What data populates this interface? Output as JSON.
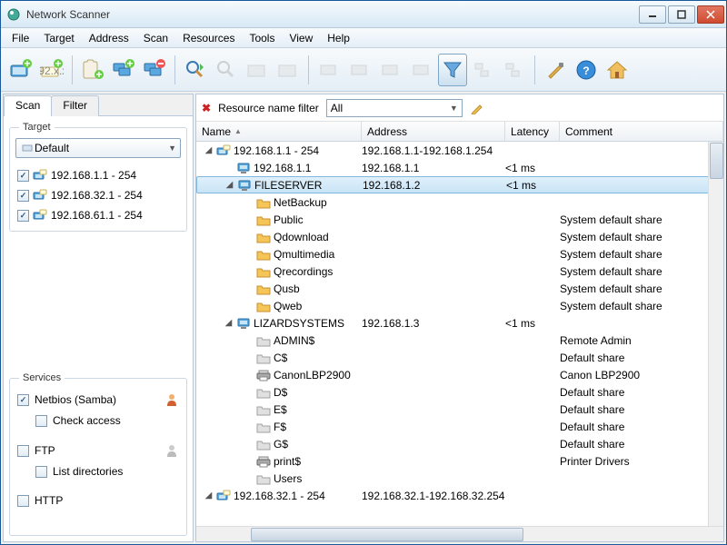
{
  "title": "Network Scanner",
  "menu": [
    "File",
    "Target",
    "Address",
    "Scan",
    "Resources",
    "Tools",
    "View",
    "Help"
  ],
  "left": {
    "tabs": [
      "Scan",
      "Filter"
    ],
    "target_legend": "Target",
    "target_combo": "Default",
    "targets": [
      {
        "checked": true,
        "label": "192.168.1.1 - 254"
      },
      {
        "checked": true,
        "label": "192.168.32.1 - 254"
      },
      {
        "checked": true,
        "label": "192.168.61.1 - 254"
      }
    ],
    "services_legend": "Services",
    "services": [
      {
        "checked": true,
        "label": "Netbios (Samba)",
        "icon": "person"
      },
      {
        "checked": false,
        "label": "Check access",
        "sub": true
      },
      {
        "checked": false,
        "label": "FTP",
        "icon": "person-grey",
        "gap": true
      },
      {
        "checked": false,
        "label": "List directories",
        "sub": true
      },
      {
        "checked": false,
        "label": "HTTP",
        "gap": true
      }
    ]
  },
  "filter": {
    "label": "Resource name filter",
    "value": "All"
  },
  "columns": {
    "name": "Name",
    "addr": "Address",
    "lat": "Latency",
    "com": "Comment"
  },
  "rows": [
    {
      "level": 1,
      "exp": "▼",
      "icon": "range",
      "name": "192.168.1.1 - 254",
      "addr": "192.168.1.1-192.168.1.254"
    },
    {
      "level": 2,
      "icon": "host",
      "name": "192.168.1.1",
      "addr": "192.168.1.1",
      "lat": "<1 ms"
    },
    {
      "level": 2,
      "exp": "▼",
      "icon": "host",
      "name": "FILESERVER",
      "addr": "192.168.1.2",
      "lat": "<1 ms",
      "selected": true
    },
    {
      "level": 3,
      "icon": "folder",
      "name": "NetBackup"
    },
    {
      "level": 3,
      "icon": "folder",
      "name": "Public",
      "com": "System default share"
    },
    {
      "level": 3,
      "icon": "folder",
      "name": "Qdownload",
      "com": "System default share"
    },
    {
      "level": 3,
      "icon": "folder",
      "name": "Qmultimedia",
      "com": "System default share"
    },
    {
      "level": 3,
      "icon": "folder",
      "name": "Qrecordings",
      "com": "System default share"
    },
    {
      "level": 3,
      "icon": "folder",
      "name": "Qusb",
      "com": "System default share"
    },
    {
      "level": 3,
      "icon": "folder",
      "name": "Qweb",
      "com": "System default share"
    },
    {
      "level": 2,
      "exp": "▼",
      "icon": "host",
      "name": "LIZARDSYSTEMS",
      "addr": "192.168.1.3",
      "lat": "<1 ms"
    },
    {
      "level": 3,
      "icon": "folder-g",
      "name": "ADMIN$",
      "com": "Remote Admin"
    },
    {
      "level": 3,
      "icon": "folder-g",
      "name": "C$",
      "com": "Default share"
    },
    {
      "level": 3,
      "icon": "printer",
      "name": "CanonLBP2900",
      "com": "Canon LBP2900"
    },
    {
      "level": 3,
      "icon": "folder-g",
      "name": "D$",
      "com": "Default share"
    },
    {
      "level": 3,
      "icon": "folder-g",
      "name": "E$",
      "com": "Default share"
    },
    {
      "level": 3,
      "icon": "folder-g",
      "name": "F$",
      "com": "Default share"
    },
    {
      "level": 3,
      "icon": "folder-g",
      "name": "G$",
      "com": "Default share"
    },
    {
      "level": 3,
      "icon": "printer",
      "name": "print$",
      "com": "Printer Drivers"
    },
    {
      "level": 3,
      "icon": "folder-g",
      "name": "Users"
    },
    {
      "level": 1,
      "exp": "▼",
      "icon": "range",
      "name": "192.168.32.1 - 254",
      "addr": "192.168.32.1-192.168.32.254"
    }
  ]
}
